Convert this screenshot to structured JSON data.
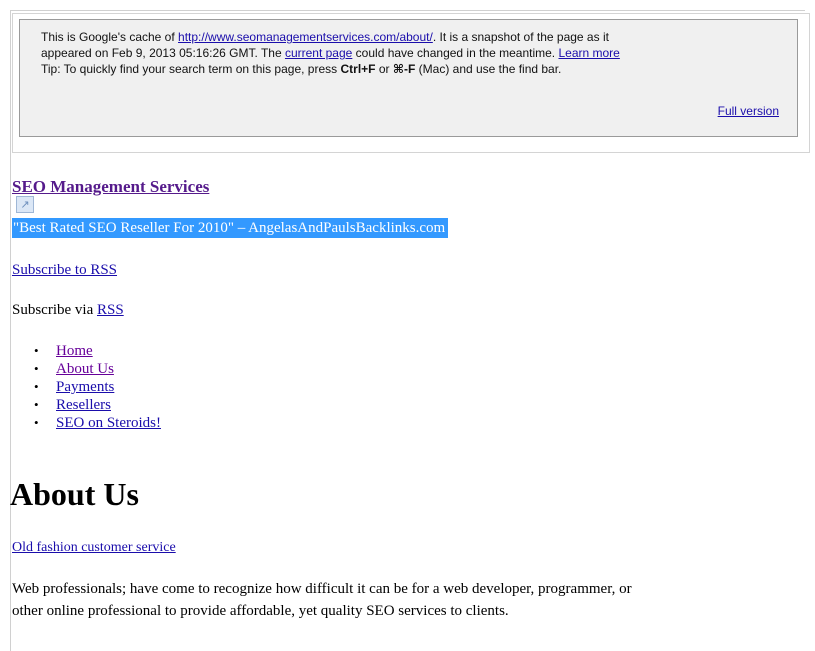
{
  "cache_notice": {
    "line1_prefix": "This is Google's cache of ",
    "cached_url": "http://www.seomanagementservices.com/about/",
    "line1_suffix": ". It is a snapshot of the page as it",
    "line2_prefix": "appeared on Feb 9, 2013 05:16:26 GMT. The ",
    "current_page_link": "current page",
    "line2_mid": " could have changed in the meantime. ",
    "learn_more_link": "Learn more",
    "tip_prefix": "Tip: To quickly find your search term on this page, press ",
    "tip_key1": "Ctrl+F",
    "tip_or": " or ",
    "tip_key2": "⌘-F",
    "tip_suffix": " (Mac) and use the find bar.",
    "full_version_link": "Full version"
  },
  "site": {
    "title": "SEO Management Services",
    "tagline": "\"Best Rated SEO Reseller For 2010\" – AngelasAndPaulsBacklinks.com",
    "subscribe_rss_link": "Subscribe to RSS",
    "subscribe_via_text": "Subscribe via ",
    "rss_link": "RSS"
  },
  "nav": {
    "items": [
      {
        "label": "Home"
      },
      {
        "label": "About Us"
      },
      {
        "label": "Payments"
      },
      {
        "label": "Resellers"
      },
      {
        "label": "SEO on Steroids!"
      }
    ]
  },
  "content": {
    "heading": "About Us",
    "sub_link": "Old fashion customer service",
    "paragraph_line1": "Web professionals; have come to recognize how difficult it can be for a web developer, programmer, or",
    "paragraph_line2": "other online professional to provide affordable, yet quality SEO services to clients."
  }
}
